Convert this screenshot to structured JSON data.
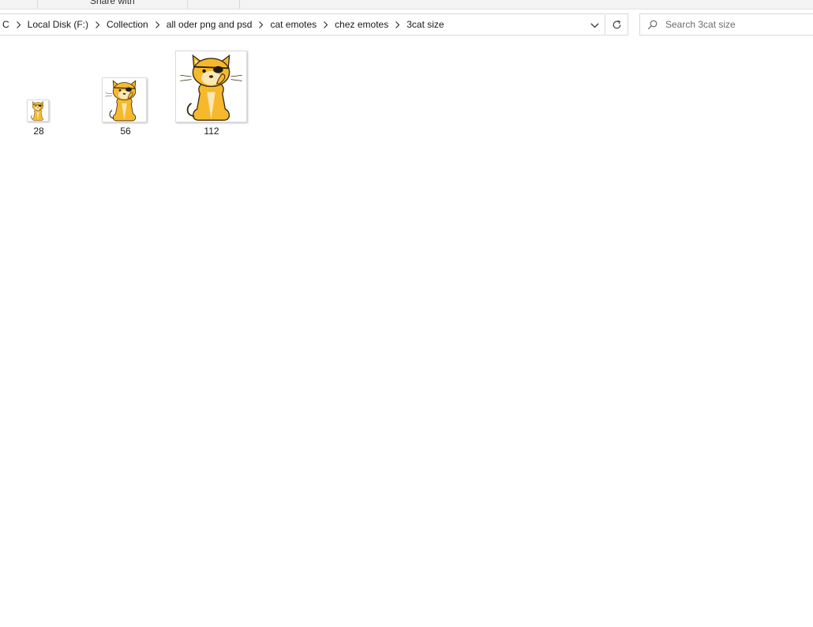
{
  "ribbon": {
    "visible_tab": "Share with"
  },
  "address_bar": {
    "breadcrumbs": [
      "C",
      "Local Disk (F:)",
      "Collection",
      "all oder png and psd",
      "cat emotes",
      "chez emotes",
      "3cat size"
    ],
    "dropdown_icon": "chevron-down-icon",
    "refresh_icon": "refresh-icon"
  },
  "search": {
    "placeholder": "Search 3cat size",
    "value": "",
    "icon": "search-icon"
  },
  "files": [
    {
      "name": "28"
    },
    {
      "name": "56"
    },
    {
      "name": "112"
    }
  ],
  "colors": {
    "cat_body": "#F5B92B",
    "cat_outline": "#3a2a10",
    "eyepatch": "#1c1c1c",
    "border": "#d9d9d9"
  }
}
